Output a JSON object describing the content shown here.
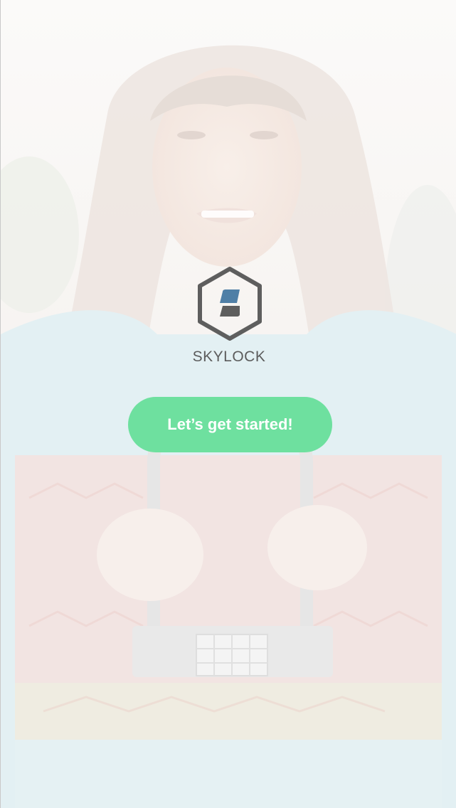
{
  "brand": {
    "name": "SKYLOCK",
    "logo_icon": "skylock-hexagon-logo-icon"
  },
  "onboarding": {
    "cta_label": "Let’s get started!"
  },
  "colors": {
    "accent_green": "#6ee09f",
    "logo_gray": "#5e5e5e",
    "logo_blue": "#4f7fa6",
    "text_gray": "#5c5c5c"
  }
}
